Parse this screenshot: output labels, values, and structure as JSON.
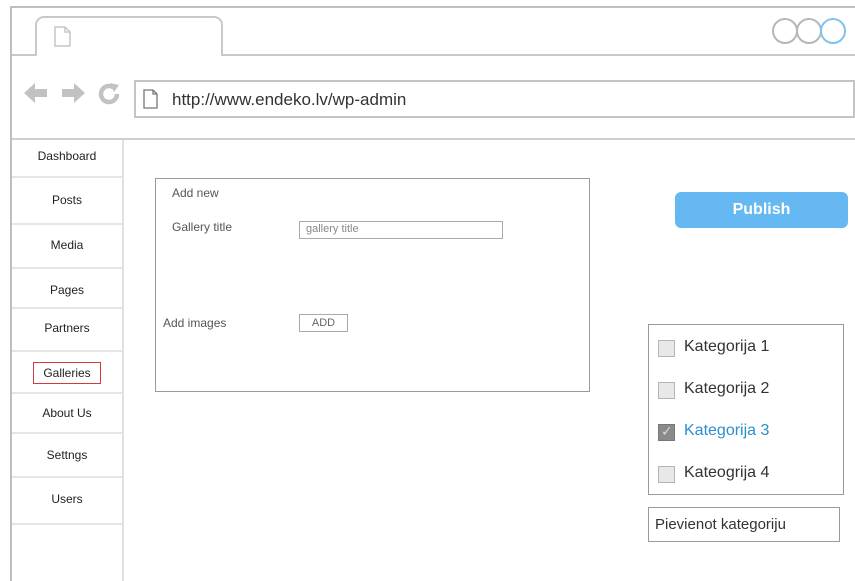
{
  "browser": {
    "url": "http://www.endeko.lv/wp-admin"
  },
  "sidebar": {
    "items": [
      {
        "label": "Dashboard",
        "active": false
      },
      {
        "label": "Posts",
        "active": false
      },
      {
        "label": "Media",
        "active": false
      },
      {
        "label": "Pages",
        "active": false
      },
      {
        "label": "Partners",
        "active": false
      },
      {
        "label": "Galleries",
        "active": true
      },
      {
        "label": "About Us",
        "active": false
      },
      {
        "label": "Settngs",
        "active": false
      },
      {
        "label": "Users",
        "active": false
      }
    ]
  },
  "form": {
    "heading": "Add new",
    "gallery_title_label": "Gallery title",
    "gallery_title_placeholder": "gallery title",
    "add_images_label": "Add images",
    "add_button": "ADD"
  },
  "publish_label": "Publish",
  "categories": [
    {
      "label": "Kategorija 1",
      "checked": false
    },
    {
      "label": "Kategorija 2",
      "checked": false
    },
    {
      "label": "Kategorija 3",
      "checked": true
    },
    {
      "label": "Kateogrija 4",
      "checked": false
    }
  ],
  "add_category_label": "Pievienot kategoriju",
  "colors": {
    "accent": "#66b8f2",
    "selected_category": "#2b8fce",
    "highlight_border": "#d23b3b"
  },
  "icons": {
    "back": "arrow-left-icon",
    "forward": "arrow-right-icon",
    "reload": "reload-icon",
    "page": "page-icon"
  }
}
